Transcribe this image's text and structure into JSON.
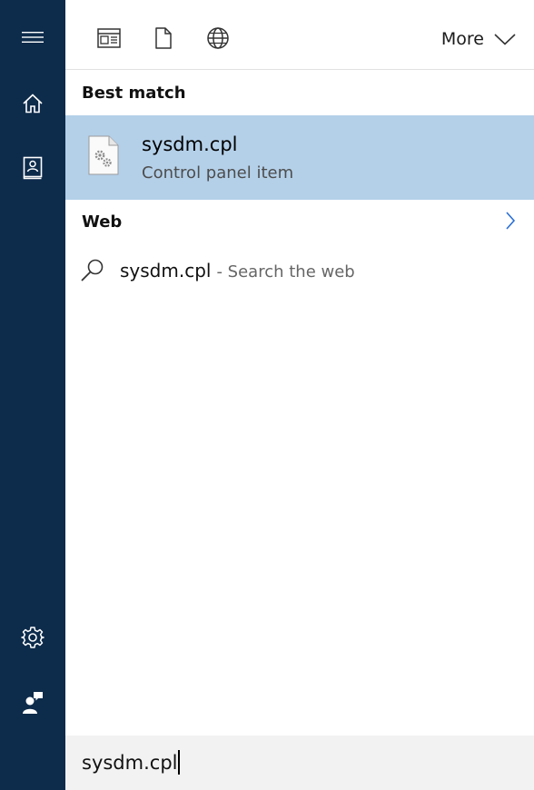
{
  "rail": {
    "items": [
      {
        "name": "hamburger-menu-icon"
      },
      {
        "name": "home-icon"
      },
      {
        "name": "notebook-icon"
      },
      {
        "name": "settings-gear-icon"
      },
      {
        "name": "feedback-person-icon"
      }
    ]
  },
  "toolbar": {
    "filters": [
      {
        "icon": "apps-filter-icon"
      },
      {
        "icon": "documents-filter-icon"
      },
      {
        "icon": "web-filter-icon"
      }
    ],
    "more_label": "More"
  },
  "best_match": {
    "header": "Best match",
    "item": {
      "title": "sysdm.cpl",
      "subtitle": "Control panel item",
      "icon": "control-panel-file-icon"
    }
  },
  "web": {
    "header": "Web",
    "item": {
      "query": "sysdm.cpl",
      "suffix": "- Search the web"
    }
  },
  "search": {
    "value": "sysdm.cpl"
  },
  "colors": {
    "rail_bg": "#0d2b4b",
    "selected_bg": "#b4d0e9",
    "searchbox_bg": "#f2f2f2",
    "accent": "#2a6fd6"
  }
}
